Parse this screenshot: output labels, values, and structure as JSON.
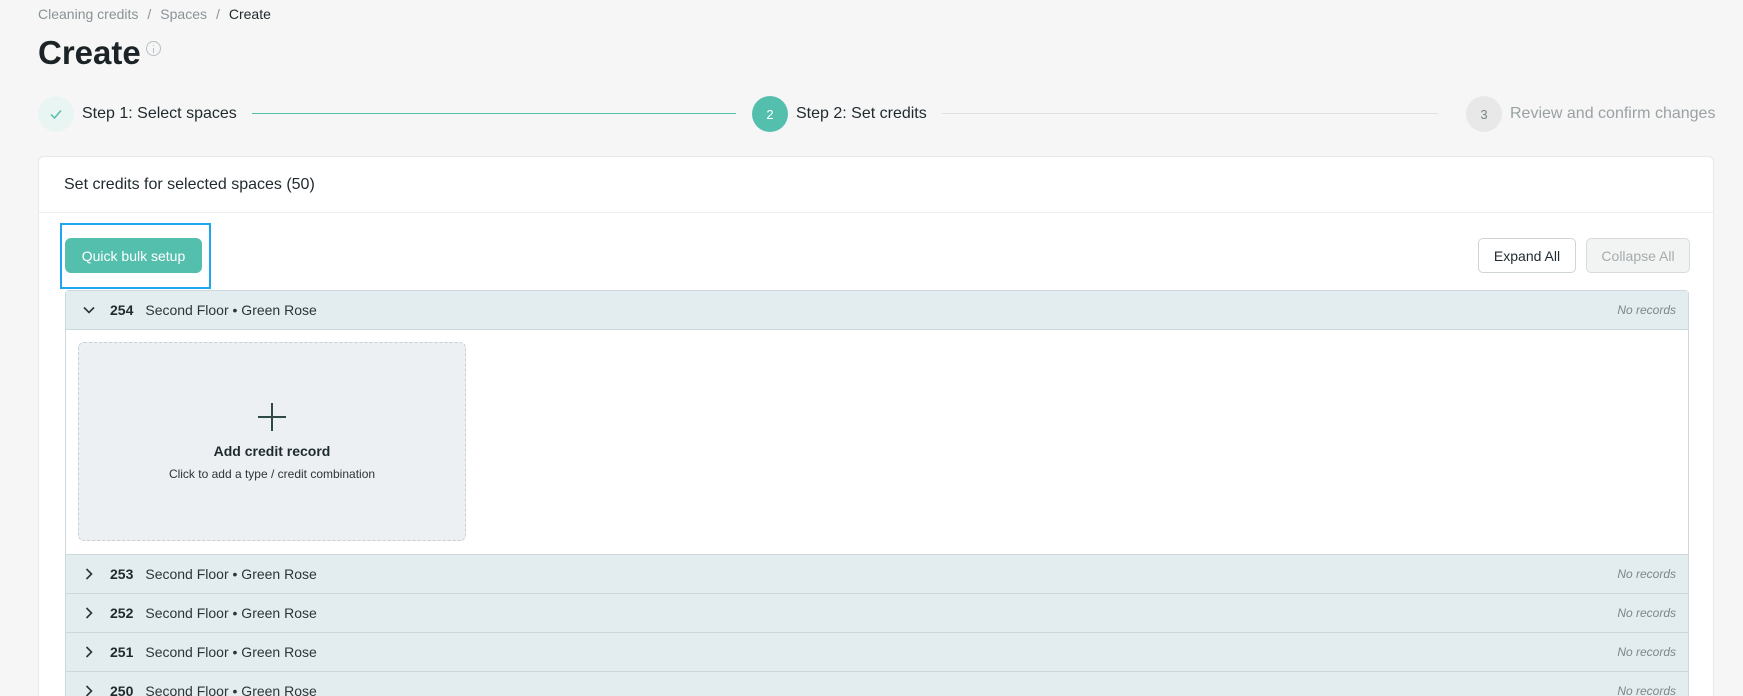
{
  "breadcrumb": {
    "items": [
      "Cleaning credits",
      "Spaces"
    ],
    "current": "Create",
    "separator": "/"
  },
  "page": {
    "title": "Create"
  },
  "stepper": {
    "steps": [
      {
        "number": "",
        "label": "Step 1: Select spaces",
        "state": "done"
      },
      {
        "number": "2",
        "label": "Step 2: Set credits",
        "state": "active"
      },
      {
        "number": "3",
        "label": "Review and confirm changes",
        "state": "pending"
      }
    ]
  },
  "card": {
    "title": "Set credits for selected spaces (50)",
    "quick_bulk_label": "Quick bulk setup",
    "expand_all_label": "Expand All",
    "collapse_all_label": "Collapse All"
  },
  "spaces": [
    {
      "number": "254",
      "name": "Second Floor • Green Rose",
      "status": "No records",
      "expanded": true
    },
    {
      "number": "253",
      "name": "Second Floor • Green Rose",
      "status": "No records",
      "expanded": false
    },
    {
      "number": "252",
      "name": "Second Floor • Green Rose",
      "status": "No records",
      "expanded": false
    },
    {
      "number": "251",
      "name": "Second Floor • Green Rose",
      "status": "No records",
      "expanded": false
    },
    {
      "number": "250",
      "name": "Second Floor • Green Rose",
      "status": "No records",
      "expanded": false
    }
  ],
  "add_credit": {
    "title": "Add credit record",
    "subtitle": "Click to add a type / credit combination"
  },
  "colors": {
    "accent": "#55bfae",
    "highlight": "#1ea7f0",
    "row_bg": "#e3ecee",
    "page_bg": "#f6f6f6"
  },
  "icons": {
    "done_step": "check-icon",
    "expanded_row": "chevron-down-icon",
    "collapsed_row": "chevron-right-icon",
    "add": "plus-icon",
    "title_info": "info-icon"
  }
}
